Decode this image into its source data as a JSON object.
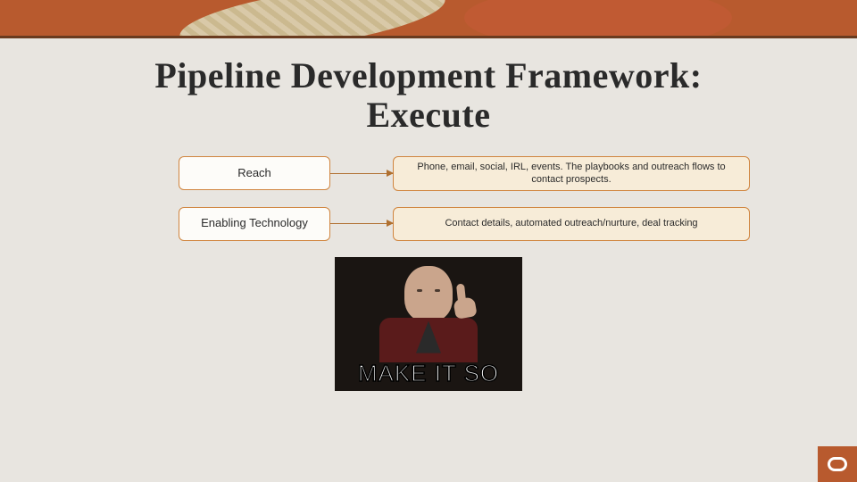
{
  "title": {
    "line1": "Pipeline Development Framework:",
    "line2": "Execute"
  },
  "rows": [
    {
      "label": "Reach",
      "description": "Phone, email, social, IRL, events. The playbooks and outreach flows to contact prospects."
    },
    {
      "label": "Enabling Technology",
      "description": "Contact details, automated outreach/nurture, deal tracking"
    }
  ],
  "meme": {
    "caption": "MAKE IT SO"
  },
  "colors": {
    "accent": "#b85a2e",
    "boxBorder": "#d0853f",
    "boxFillLight": "#fdfcf9",
    "boxFillWarm": "#f7ecd8",
    "background": "#e8e5e0"
  }
}
